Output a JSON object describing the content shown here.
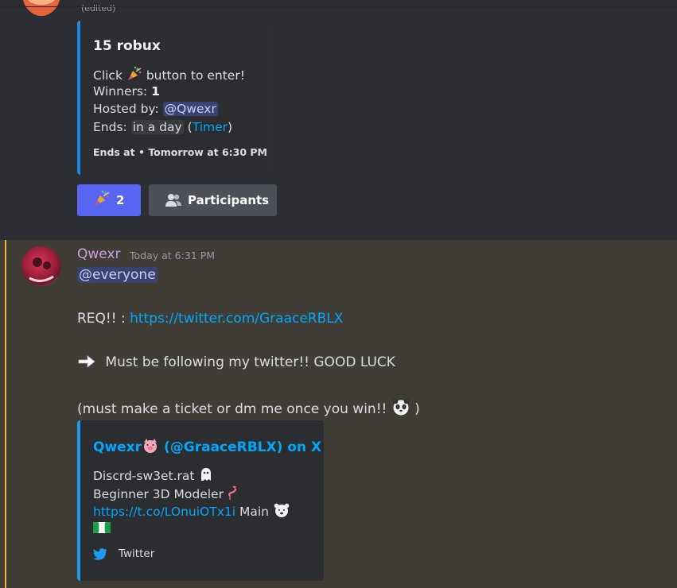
{
  "message_top": {
    "edited_label": "(edited)",
    "embed": {
      "title": "15 robux",
      "line1_prefix": "Click",
      "line1_suffix": "button to enter!",
      "winners_label": "Winners:",
      "winners_value": "1",
      "hosted_label": "Hosted by:",
      "host_mention": "@Qwexr",
      "ends_label": "Ends:",
      "ends_value": "in a day",
      "timer_link": "Timer",
      "footer_label": "Ends at",
      "footer_sep": "•",
      "footer_value": "Tomorrow at 6:30 PM"
    },
    "buttons": {
      "enter_count": "2",
      "participants_label": "Participants"
    }
  },
  "message_main": {
    "username": "Qwexr",
    "timestamp": "Today at 6:31 PM",
    "mention": "@everyone",
    "req_prefix": "REQ!! :",
    "req_link": "https://twitter.com/GraaceRBLX",
    "follow_text": "Must be following my twitter!! GOOD LUCK",
    "ticket_text": "(must make a ticket or dm me once you win!!",
    "ticket_close": ")",
    "embed": {
      "title_name": "Qwexr",
      "title_rest": "(@GraaceRBLX) on X",
      "desc_line1": "Discrd-sw3et.rat",
      "desc_line2": "Beginner 3D Modeler",
      "desc_link": "https://t.co/LOnuiOTx1i",
      "desc_link_suffix": "Main",
      "footer_label": "Twitter"
    }
  },
  "colors": {
    "accent_button": "#5865f2",
    "secondary_button": "#4e5058",
    "link": "#00a8fc",
    "embed_border": "#1e88e5",
    "highlight_bar": "#f0b232",
    "username": "#c9a0dc"
  }
}
